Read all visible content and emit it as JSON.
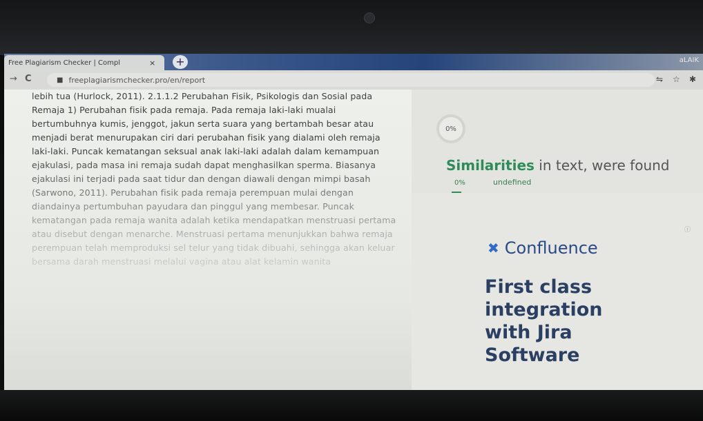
{
  "browser": {
    "tab_title": "Free Plagiarism Checker | Compl",
    "tab_close": "×",
    "new_tab": "+",
    "profile_label": "aLAIK",
    "nav_back": "→",
    "nav_reload": "C",
    "url": "freeplagiarismchecker.pro/en/report",
    "lock_icon": "lock-icon",
    "toolbar_icons": [
      "translate-icon",
      "star-icon",
      "extensions-icon"
    ]
  },
  "article": {
    "text": "lebih tua (Hurlock, 2011). 2.1.1.2 Perubahan Fisik, Psikologis dan Sosial pada Remaja 1) Perubahan fisik pada remaja. Pada remaja laki-laki mualai bertumbuhnya kumis, jenggot, jakun serta suara yang bertambah besar atau menjadi berat menurupakan ciri dari perubahan fisik yang dialami oleh remaja laki-laki. Puncak kematangan seksual anak laki-laki adalah dalam kemampuan ejakulasi, pada masa ini remaja sudah dapat menghasilkan sperma. Biasanya ejakulasi ini terjadi pada saat tidur dan dengan diawali dengan mimpi basah (Sarwono, 2011). Perubahan fisik pada remaja perempuan mulai dengan diandainya pertumbuhan payudara dan pinggul yang membesar. Puncak kematangan pada remaja wanita adalah ketika mendapatkan menstruasi pertama atau disebut dengan menarche. Menstruasi pertama menunjukkan bahwa remaja perempuan telah memproduksi sel telur yang tidak dibuahi, sehingga akan keluar bersama darah menstruasi melalui vagina atau alat kelamin wanita"
  },
  "result": {
    "percent": "0%",
    "similarities_strong": "Similarities",
    "similarities_rest": " in text, were found",
    "mini_percent": "0%",
    "mini_label": "undefined"
  },
  "ad": {
    "info_icon": "ⓘ",
    "logo_icon": "✖",
    "brand": "Confluence",
    "headline": "First class integration with Jira Software"
  }
}
